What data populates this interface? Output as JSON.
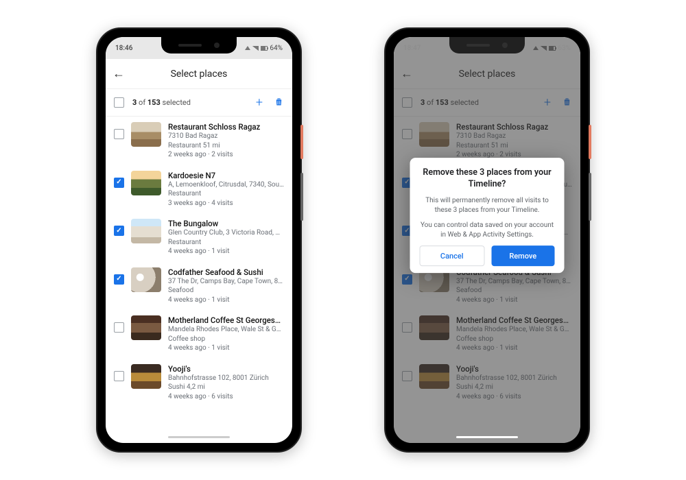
{
  "colors": {
    "accent": "#1a73e8"
  },
  "phone1": {
    "status": {
      "time": "18:46",
      "battery": "64%"
    },
    "header": {
      "title": "Select places"
    },
    "selection": {
      "count": "3",
      "total": "153",
      "suffix": " selected"
    },
    "items": [
      {
        "checked": false,
        "thumb": "t1",
        "name": "Restaurant Schloss Ragaz",
        "address": "7310 Bad Ragaz",
        "category": "Restaurant 51 mi",
        "meta": "2 weeks ago · 2 visits"
      },
      {
        "checked": true,
        "thumb": "t2",
        "name": "Kardoesie N7",
        "address": "A, Lemoenkloof, Citrusdal, 7340, Sout…",
        "category": "Restaurant",
        "meta": "3 weeks ago · 4 visits"
      },
      {
        "checked": true,
        "thumb": "t3",
        "name": "The Bungalow",
        "address": "Glen Country Club, 3 Victoria Road, Cli…",
        "category": "Restaurant",
        "meta": "4 weeks ago · 1 visit"
      },
      {
        "checked": true,
        "thumb": "t4",
        "name": "Codfather Seafood & Sushi",
        "address": "37 The Dr, Camps Bay, Cape Town, 80…",
        "category": "Seafood",
        "meta": "4 weeks ago · 1 visit"
      },
      {
        "checked": false,
        "thumb": "t5",
        "name": "Motherland Coffee St Georges…",
        "address": "Mandela Rhodes Place, Wale St & Geo…",
        "category": "Coffee shop",
        "meta": "4 weeks ago · 1 visit"
      },
      {
        "checked": false,
        "thumb": "t6",
        "name": "Yooji's",
        "address": "Bahnhofstrasse 102, 8001 Zürich",
        "category": "Sushi 4,2 mi",
        "meta": "4 weeks ago · 6 visits"
      }
    ]
  },
  "phone2": {
    "status": {
      "time": "18:47",
      "battery": "63%"
    },
    "dialog": {
      "title": "Remove these 3 places from your Timeline?",
      "body1": "This will permanently remove all visits to these 3 places from your Timeline.",
      "body2": "You can control data saved on your account in Web & App Activity Settings.",
      "cancel": "Cancel",
      "confirm": "Remove"
    }
  }
}
